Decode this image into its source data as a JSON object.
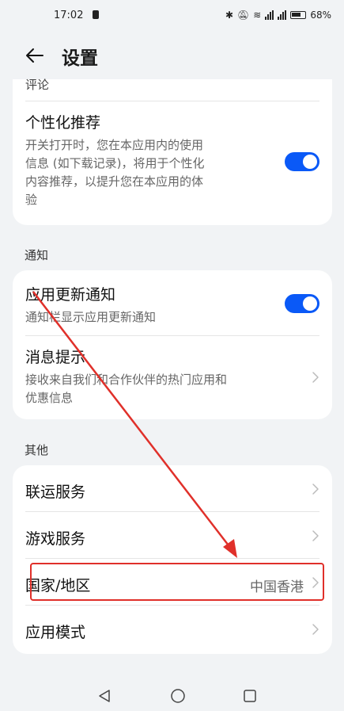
{
  "status": {
    "time": "17:02",
    "signal1": "4G",
    "signal2": "4G",
    "battery": "68%"
  },
  "header": {
    "title": "设置"
  },
  "section1": {
    "partial_item": "评论",
    "personalized": {
      "title": "个性化推荐",
      "desc_lines": [
        "开关打开时，您在本应用内的使用",
        "信息 (如下载记录)，将用于个性化",
        "内容推荐，以提升您在本应用的体",
        "验"
      ],
      "enabled": true
    }
  },
  "notify": {
    "label": "通知",
    "update": {
      "title": "应用更新通知",
      "desc": "通知栏显示应用更新通知",
      "enabled": true
    },
    "message": {
      "title": "消息提示",
      "desc_lines": [
        "接收来自我们和合作伙伴的热门应用和",
        "优惠信息"
      ]
    }
  },
  "other": {
    "label": "其他",
    "items": [
      {
        "title": "联运服务",
        "value": ""
      },
      {
        "title": "游戏服务",
        "value": ""
      },
      {
        "title": "国家/地区",
        "value": "中国香港"
      },
      {
        "title": "应用模式",
        "value": ""
      }
    ]
  },
  "colors": {
    "accent": "#0a59f7",
    "annotation": "#e0302a",
    "background": "#f1f3f5"
  }
}
